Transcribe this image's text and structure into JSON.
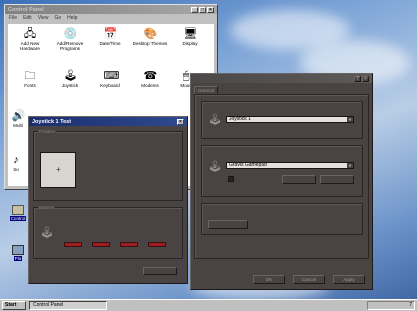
{
  "control_panel": {
    "title": "Control Panel",
    "menu": [
      "File",
      "Edit",
      "View",
      "Go",
      "Help"
    ],
    "icons": [
      {
        "label": "Add New Hardware",
        "icon": "add-hardware-icon"
      },
      {
        "label": "Add/Remove Programs",
        "icon": "add-remove-programs-icon"
      },
      {
        "label": "Date/Time",
        "icon": "date-time-icon"
      },
      {
        "label": "Desktop Themes",
        "icon": "desktop-themes-icon"
      },
      {
        "label": "Display",
        "icon": "display-icon"
      },
      {
        "label": "Fonts",
        "icon": "fonts-icon"
      },
      {
        "label": "Joystick",
        "icon": "joystick-icon"
      },
      {
        "label": "Keyboard",
        "icon": "keyboard-icon"
      },
      {
        "label": "Modems",
        "icon": "modems-icon"
      },
      {
        "label": "Mous",
        "icon": "mouse-icon"
      },
      {
        "label": "Multi",
        "icon": "multimedia-icon"
      },
      {
        "label": "So",
        "icon": "sounds-icon"
      }
    ]
  },
  "joystick_test": {
    "title": "Joystick 1 Test",
    "group_position": "Position",
    "group_buttons": "Buttons",
    "position_marker": "+"
  },
  "game_controllers": {
    "tab_general": "General",
    "joystick_select": "Joystick 1",
    "controller_select": "Gravis Gamepad",
    "ok": "OK",
    "cancel": "Cancel",
    "apply": "Apply"
  },
  "desktop": {
    "icon_control": "Control",
    "icon_placeholder": "Pla"
  },
  "taskbar": {
    "start": "Start",
    "task_control_panel": "Control Panel",
    "tray_time": "7"
  },
  "colors": {
    "dark_dialog": "#4a4343",
    "active_title": "#1b2e6e",
    "button_red": "#9b1f1f"
  }
}
